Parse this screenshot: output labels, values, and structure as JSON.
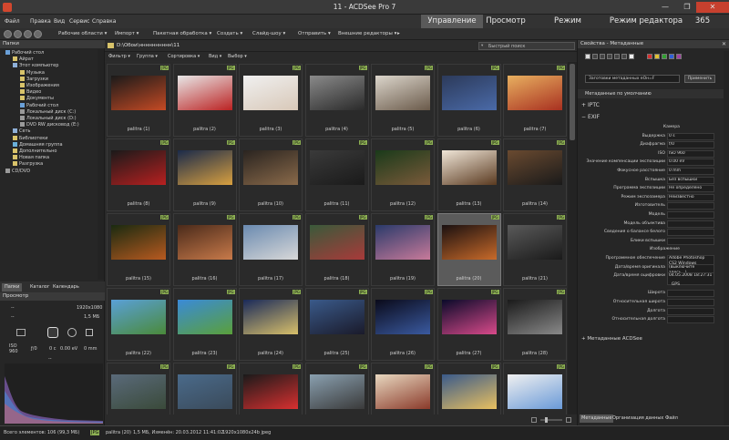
{
  "window": {
    "title": "11 - ACDSee Pro 7",
    "minimize": "—",
    "maximize": "❐",
    "close": "✕"
  },
  "menu": [
    "Файл",
    "Правка",
    "Вид",
    "Сервис",
    "Справка"
  ],
  "modes": [
    "Управление",
    "Просмотр",
    "Режим коррекции",
    "Режим редактора",
    "365"
  ],
  "toolbar": {
    "items": [
      "Рабочие области ▾",
      "Импорт ▾",
      "Пакетная обработка ▾",
      "Создать ▾",
      "Слайд-шоу ▾",
      "Отправить ▾",
      "Внешние редакторы ▾",
      "▸"
    ]
  },
  "folders": {
    "header": "Папки",
    "items": [
      {
        "label": "Рабочий стол",
        "level": 0,
        "color": "#6aa0d8"
      },
      {
        "label": "Айрат",
        "level": 1,
        "color": "#d8c36a"
      },
      {
        "label": "Этот компьютер",
        "level": 1,
        "color": "#8fb0d8"
      },
      {
        "label": "Музыка",
        "level": 2,
        "color": "#d8c36a"
      },
      {
        "label": "Загрузки",
        "level": 2,
        "color": "#d8c36a"
      },
      {
        "label": "Изображения",
        "level": 2,
        "color": "#d8c36a"
      },
      {
        "label": "Видео",
        "level": 2,
        "color": "#d8c36a"
      },
      {
        "label": "Документы",
        "level": 2,
        "color": "#d8c36a"
      },
      {
        "label": "Рабочий стол",
        "level": 2,
        "color": "#6aa0d8"
      },
      {
        "label": "Локальный диск (C:)",
        "level": 2,
        "color": "#9a9a9a"
      },
      {
        "label": "Локальный диск (D:)",
        "level": 2,
        "color": "#9a9a9a"
      },
      {
        "label": "DVD RW дисковод (E:)",
        "level": 2,
        "color": "#9a9a9a"
      },
      {
        "label": "Сеть",
        "level": 1,
        "color": "#8fb0d8"
      },
      {
        "label": "Библиотеки",
        "level": 1,
        "color": "#d8c36a"
      },
      {
        "label": "Домашняя группа",
        "level": 1,
        "color": "#6ab0d8"
      },
      {
        "label": "Дополнительно",
        "level": 1,
        "color": "#d8c36a"
      },
      {
        "label": "Новая папка",
        "level": 1,
        "color": "#d8c36a"
      },
      {
        "label": "Разгрузка",
        "level": 1,
        "color": "#d8c36a"
      },
      {
        "label": "CD/DVD",
        "level": 0,
        "color": "#9a9a9a"
      }
    ]
  },
  "left_tabs": [
    "Папки",
    "Каталог",
    "Календарь"
  ],
  "preview": {
    "header": "Просмотр",
    "dim1": "--",
    "res": "1920x1080",
    "dim2": "--",
    "size": "1,5 МБ",
    "iso": "ISO 960",
    "fstop": "ƒ/0",
    "shutter": "0 с",
    "ev": "0.00 eV",
    "focal": "0 mm",
    "dash": "--"
  },
  "path": {
    "path": "D:\\Обои\\нннннннннн\\11",
    "search_placeholder": "Быстрый поиск"
  },
  "filter_bar": [
    "Фильтр ▾",
    "Группа ▾",
    "Сортировка ▾",
    "Вид ▾",
    "Выбор ▾"
  ],
  "jpg_badge": "JPG",
  "thumbnails": [
    {
      "caption": "palitra (1)",
      "colors": [
        "#1a1a1a",
        "#c54a24"
      ]
    },
    {
      "caption": "palitra (2)",
      "colors": [
        "#e8e8e8",
        "#b22"
      ]
    },
    {
      "caption": "palitra (3)",
      "colors": [
        "#f0f0f0",
        "#d8c8b8"
      ]
    },
    {
      "caption": "palitra (4)",
      "colors": [
        "#8a8a8a",
        "#2a2a2a"
      ]
    },
    {
      "caption": "palitra (5)",
      "colors": [
        "#dcd6cc",
        "#6a5a4a"
      ]
    },
    {
      "caption": "palitra (6)",
      "colors": [
        "#2c3a5a",
        "#4a6aa8"
      ]
    },
    {
      "caption": "palitra (7)",
      "colors": [
        "#e8b060",
        "#a83020"
      ]
    },
    {
      "caption": "palitra (8)",
      "colors": [
        "#1a1a1a",
        "#b82020"
      ]
    },
    {
      "caption": "palitra (9)",
      "colors": [
        "#1a2a4a",
        "#d8a040"
      ]
    },
    {
      "caption": "palitra (10)",
      "colors": [
        "#2a2420",
        "#8a6a4a"
      ]
    },
    {
      "caption": "palitra (11)",
      "colors": [
        "#3a3a3a",
        "#1a1a1a"
      ]
    },
    {
      "caption": "palitra (12)",
      "colors": [
        "#1a3a1a",
        "#7a5a3a"
      ]
    },
    {
      "caption": "palitra (13)",
      "colors": [
        "#f0e6d8",
        "#5a3a20"
      ]
    },
    {
      "caption": "palitra (14)",
      "colors": [
        "#6a4a30",
        "#1a1a1a"
      ]
    },
    {
      "caption": "palitra (15)",
      "colors": [
        "#1a2a10",
        "#b85a20"
      ]
    },
    {
      "caption": "palitra (16)",
      "colors": [
        "#4a2a1a",
        "#c87a4a"
      ]
    },
    {
      "caption": "palitra (17)",
      "colors": [
        "#6a8ab0",
        "#d8d8d8"
      ]
    },
    {
      "caption": "palitra (18)",
      "colors": [
        "#3a5a3a",
        "#a83a3a"
      ]
    },
    {
      "caption": "palitra (19)",
      "colors": [
        "#2a3a6a",
        "#c87a9a"
      ]
    },
    {
      "caption": "palitra (20)",
      "colors": [
        "#1a1010",
        "#c86a2a"
      ]
    },
    {
      "caption": "palitra (21)",
      "colors": [
        "#5a5a5a",
        "#1a1a1a"
      ]
    },
    {
      "caption": "palitra (22)",
      "colors": [
        "#5aa0d8",
        "#4a8a3a"
      ]
    },
    {
      "caption": "palitra (23)",
      "colors": [
        "#3a8ad8",
        "#5aa03a"
      ]
    },
    {
      "caption": "palitra (24)",
      "colors": [
        "#1a2a5a",
        "#d8c06a"
      ]
    },
    {
      "caption": "palitra (25)",
      "colors": [
        "#3a5a8a",
        "#1a1a2a"
      ]
    },
    {
      "caption": "palitra (26)",
      "colors": [
        "#0a0a1a",
        "#3a5aa0"
      ]
    },
    {
      "caption": "palitra (27)",
      "colors": [
        "#0a0a2a",
        "#d84a8a"
      ]
    },
    {
      "caption": "palitra (28)",
      "colors": [
        "#1a1a1a",
        "#8a8a8a"
      ]
    },
    {
      "caption": "",
      "colors": [
        "#5a6a7a",
        "#3a4a3a"
      ]
    },
    {
      "caption": "",
      "colors": [
        "#4a6a8a",
        "#3a4a5a"
      ]
    },
    {
      "caption": "",
      "colors": [
        "#1a1a1a",
        "#d83030"
      ]
    },
    {
      "caption": "",
      "colors": [
        "#8aa0b0",
        "#3a3a3a"
      ]
    },
    {
      "caption": "",
      "colors": [
        "#e8d8c0",
        "#8a3a2a"
      ]
    },
    {
      "caption": "",
      "colors": [
        "#3a5a8a",
        "#e8c060"
      ]
    },
    {
      "caption": "",
      "colors": [
        "#f0f0f0",
        "#6a9ad8"
      ]
    }
  ],
  "selected_index": 19,
  "right_panel": {
    "header": "Свойства - Метаданные",
    "metadata_select": "Заготовки метаданных еОн=F",
    "apply_button": "Применить",
    "default_meta": "Метаданные по умолчанию",
    "iptc": "IPTC",
    "exif": "EXIF",
    "acdsee_meta": "Метаданные ACDSee",
    "fields": [
      {
        "label": "Камера",
        "value": null
      },
      {
        "label": "Выдержка",
        "value": "0 s"
      },
      {
        "label": "Диафрагма",
        "value": "f/0"
      },
      {
        "label": "ISO",
        "value": "ISO 960"
      },
      {
        "label": "Значение компенсации экспозиции",
        "value": "0.00 eV"
      },
      {
        "label": "Фокусное расстояние",
        "value": "0 mm"
      },
      {
        "label": "Вспышка",
        "value": "Без вспышки"
      },
      {
        "label": "Программа экспозиции",
        "value": "Не определено"
      },
      {
        "label": "Режим экспозамера",
        "value": "Неизвестно"
      },
      {
        "label": "Изготовитель",
        "value": ""
      },
      {
        "label": "Модель",
        "value": ""
      },
      {
        "label": "Модель объектива",
        "value": ""
      },
      {
        "label": "Сведения о балансе белого",
        "value": ""
      },
      {
        "label": "Блики вспышки",
        "value": ""
      },
      {
        "label": "Изображение",
        "value": null
      },
      {
        "label": "Программное обеспечение",
        "value": "Adobe Photoshop CS2 Windows"
      },
      {
        "label": "Дата/время оригинала",
        "value": "(выключите здесь...)"
      },
      {
        "label": "Дата/время оцифровки",
        "value": "04.05.2008 18:27:31"
      },
      {
        "label": "GPS",
        "value": null
      },
      {
        "label": "Широта",
        "value": ""
      },
      {
        "label": "Относительная широта",
        "value": ""
      },
      {
        "label": "Долгота",
        "value": ""
      },
      {
        "label": "Относительная долгота",
        "value": ""
      }
    ],
    "tabs": [
      "Метаданные",
      "Организация данных",
      "Файл"
    ]
  },
  "status": {
    "total": "Всего элементов: 106  (99,3 МБ)",
    "file": "palitra (20)",
    "info": "1,5 МБ, Изменён: 20.03.2012 11:41:02",
    "dims": "1920x1080x24b jpeg"
  }
}
